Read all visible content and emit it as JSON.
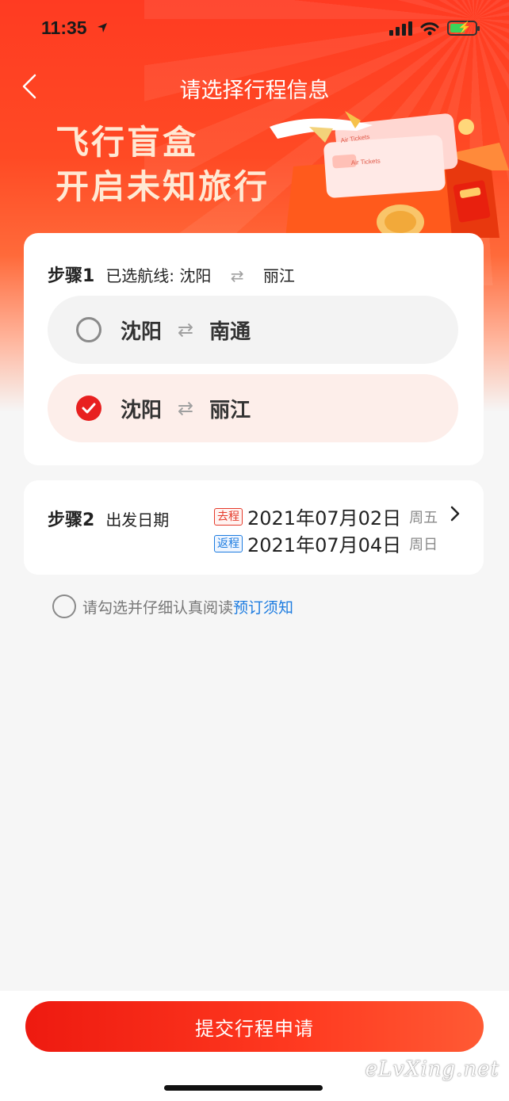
{
  "status_bar": {
    "time": "11:35"
  },
  "nav": {
    "title": "请选择行程信息"
  },
  "banner": {
    "line1": "飞行盲盒",
    "line2": "开启未知旅行",
    "ticket_text_1": "Air Tickets",
    "ticket_text_2": "Air Tickets"
  },
  "step1": {
    "step_label": "步骤1",
    "selected_prefix": "已选航线:",
    "selected_from": "沈阳",
    "selected_to": "丽江",
    "options": [
      {
        "from": "沈阳",
        "to": "南通",
        "checked": false
      },
      {
        "from": "沈阳",
        "to": "丽江",
        "checked": true
      }
    ]
  },
  "step2": {
    "step_label": "步骤2",
    "title": "出发日期",
    "outbound": {
      "tag": "去程",
      "date": "2021年07月02日",
      "weekday": "周五"
    },
    "return": {
      "tag": "返程",
      "date": "2021年07月04日",
      "weekday": "周日"
    }
  },
  "agreement": {
    "text": "请勾选并仔细认真阅读",
    "link": "预订须知"
  },
  "submit": {
    "label": "提交行程申请"
  },
  "watermark": "eLvXing.net",
  "colors": {
    "primary": "#ee1a10",
    "accent_red": "#e82020",
    "link_blue": "#1d7ce0"
  }
}
